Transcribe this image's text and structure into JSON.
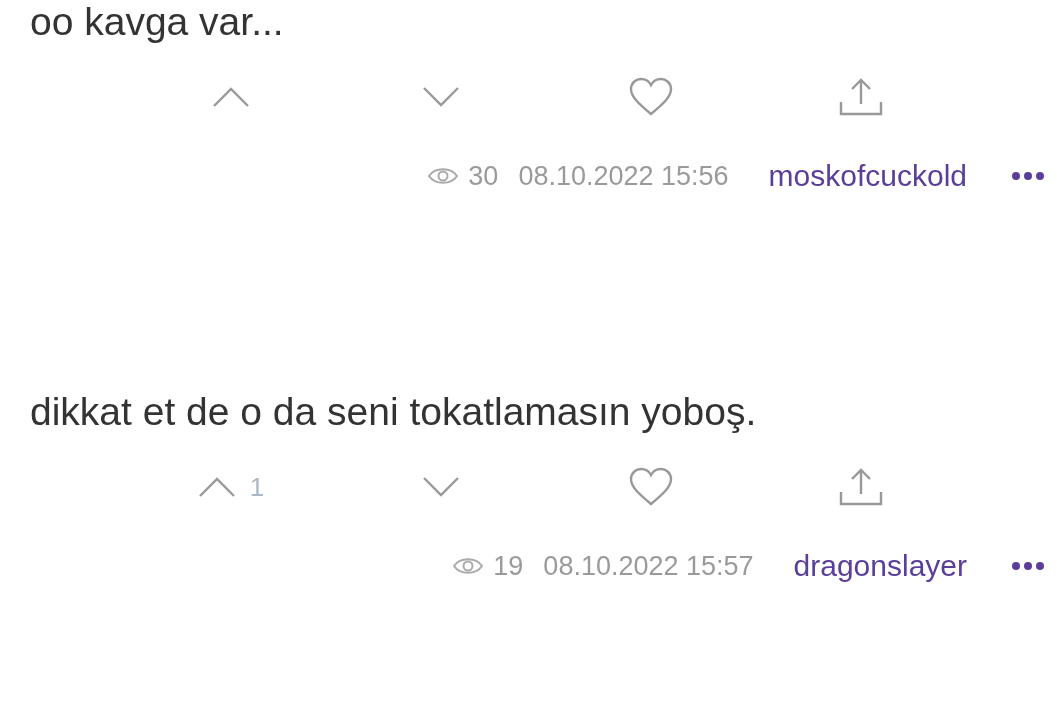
{
  "entries": [
    {
      "text": "oo kavga var...",
      "views": "30",
      "date": "08.10.2022 15:56",
      "author": "moskofcuckold"
    },
    {
      "text": "dikkat et de o da seni tokatlamasın yoboş.",
      "upvote_count": "1",
      "views": "19",
      "date": "08.10.2022 15:57",
      "author": "dragonslayer"
    }
  ]
}
